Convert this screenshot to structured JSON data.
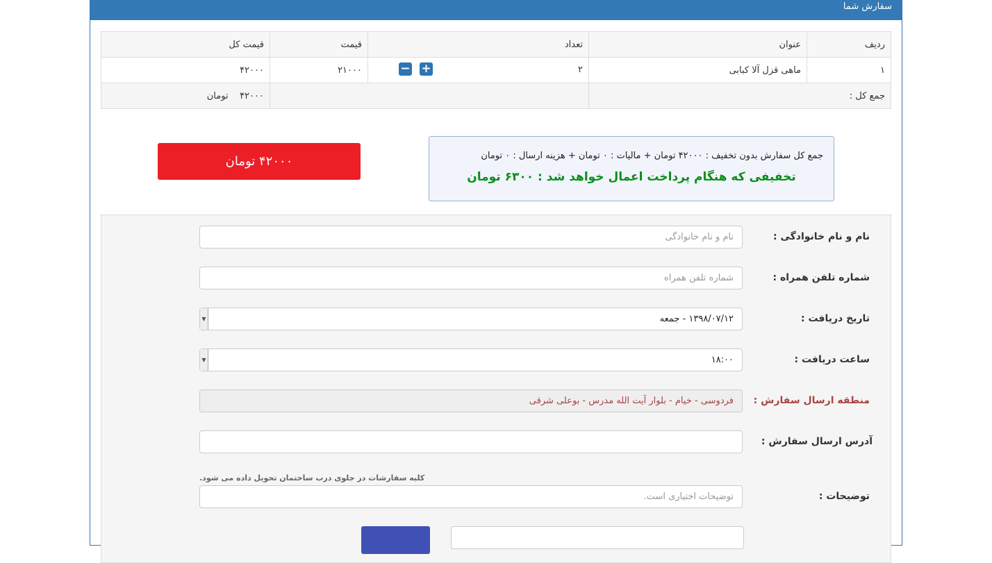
{
  "header": {
    "title": "سفارش شما"
  },
  "table": {
    "columns": [
      "ردیف",
      "عنوان",
      "تعداد",
      "قیمت",
      "قیمت کل"
    ],
    "rows": [
      {
        "index": "۱",
        "title": "ماهی قزل آلا کبابی",
        "qty": "۲",
        "price": "۲۱۰۰۰",
        "total": "۴۲۰۰۰"
      }
    ],
    "footer": {
      "label": "جمع کل :",
      "total": "۴۲۰۰۰",
      "unit": "تومان"
    }
  },
  "pay_button": {
    "label": "۴۲۰۰۰ تومان"
  },
  "summary": {
    "line1": "جمع کل سفارش بدون تخفیف : ۴۲۰۰۰ تومان + مالیات : ۰ تومان + هزینه ارسال : ۰ تومان",
    "line2": "تخفیفی که هنگام پرداخت اعمال خواهد شد : ۶۳۰۰ تومان"
  },
  "form": {
    "name": {
      "label": "نام و نام خانوادگی :",
      "placeholder": "نام و نام خانوادگی"
    },
    "phone": {
      "label": "شماره تلفن همراه :",
      "placeholder": "شماره تلفن همراه"
    },
    "date": {
      "label": "تاریخ دریافت :",
      "value": "۱۳۹۸/۰۷/۱۲ - جمعه"
    },
    "time": {
      "label": "ساعت دریافت :",
      "value": "۱۸:۰۰"
    },
    "region": {
      "label": "منطقه ارسال سفارش :",
      "value": "فردوسی - خیام - بلوار آیت الله مدرس - بوعلی شرقی"
    },
    "address": {
      "label": "آدرس ارسال سفارش :",
      "value": ""
    },
    "notes": {
      "label": "توضیحات :",
      "hint": "کلیه سفارشات در جلوی درب ساختمان تحویل داده می شود.",
      "placeholder": "توضیحات اختیاری است."
    }
  },
  "colors": {
    "header": "#337ab7",
    "pay_button": "#ec1f27",
    "discount_text": "#0a8f1a",
    "qty_buttons": "#2f74b5"
  },
  "icons": {
    "increase": "plus-square-icon",
    "decrease": "minus-square-icon"
  }
}
